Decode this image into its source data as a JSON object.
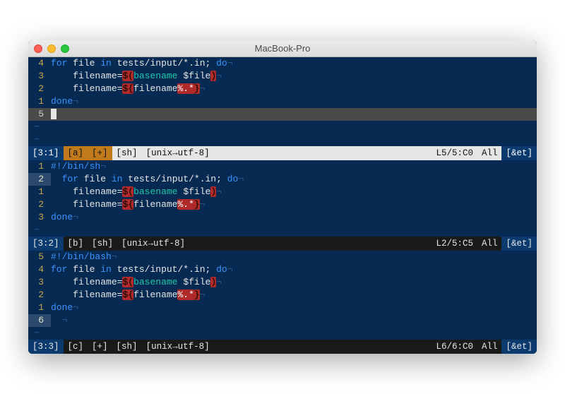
{
  "window": {
    "title": "MacBook-Pro"
  },
  "panes": [
    {
      "gutters": [
        "4",
        "3",
        "2",
        "1",
        "5"
      ],
      "shebang": null,
      "lines": {
        "for_kw": "for",
        "file_id": "file",
        "in_kw": "in",
        "glob": "tests/input/*.in",
        "semi": ";",
        "do_kw": "do",
        "fn1_lhs": "filename",
        "eq": "=",
        "doll": "$",
        "lp": "(",
        "rp": ")",
        "basename": "basename",
        "dfile": "$file",
        "fn2_lhs": "filename",
        "lb": "${",
        "inner": "filename",
        "pat": "%.*",
        "rb": "}",
        "done": "done",
        "eol": "¬"
      },
      "status": {
        "win": "[3:1]",
        "buf": "[a]",
        "mod": "[+]",
        "ft": "[sh]",
        "enc": "[unix→utf-8]",
        "pos": "L5/5:C0",
        "pct": "All",
        "tail": "[&et]"
      }
    },
    {
      "gutters": [
        "1",
        "2",
        "1",
        "2",
        "3"
      ],
      "shebang": "#!/bin/sh",
      "lines": {
        "for_kw": "for",
        "file_id": "file",
        "in_kw": "in",
        "glob": "tests/input/*.in",
        "semi": ";",
        "do_kw": "do",
        "fn1_lhs": "filename",
        "eq": "=",
        "doll": "$",
        "lp": "(",
        "rp": ")",
        "basename": "basename",
        "dfile": "$file",
        "fn2_lhs": "filename",
        "lb": "${",
        "inner": "filename",
        "pat": "%.*",
        "rb": "}",
        "done": "done",
        "eol": "¬"
      },
      "status": {
        "win": "[3:2]",
        "buf": "[b]",
        "mod": "",
        "ft": "[sh]",
        "enc": "[unix→utf-8]",
        "pos": "L2/5:C5",
        "pct": "All",
        "tail": "[&et]"
      }
    },
    {
      "gutters": [
        "5",
        "4",
        "3",
        "2",
        "1",
        "6"
      ],
      "shebang": "#!/bin/bash",
      "lines": {
        "for_kw": "for",
        "file_id": "file",
        "in_kw": "in",
        "glob": "tests/input/*.in",
        "semi": ";",
        "do_kw": "do",
        "fn1_lhs": "filename",
        "eq": "=",
        "doll": "$",
        "lp": "(",
        "rp": ")",
        "basename": "basename",
        "dfile": "$file",
        "fn2_lhs": "filename",
        "lb": "${",
        "inner": "filename",
        "pat": "%.*",
        "rb": "}",
        "done": "done",
        "eol": "¬"
      },
      "status": {
        "win": "[3:3]",
        "buf": "[c]",
        "mod": "[+]",
        "ft": "[sh]",
        "enc": "[unix→utf-8]",
        "pos": "L6/6:C0",
        "pct": "All",
        "tail": "[&et]"
      }
    }
  ]
}
